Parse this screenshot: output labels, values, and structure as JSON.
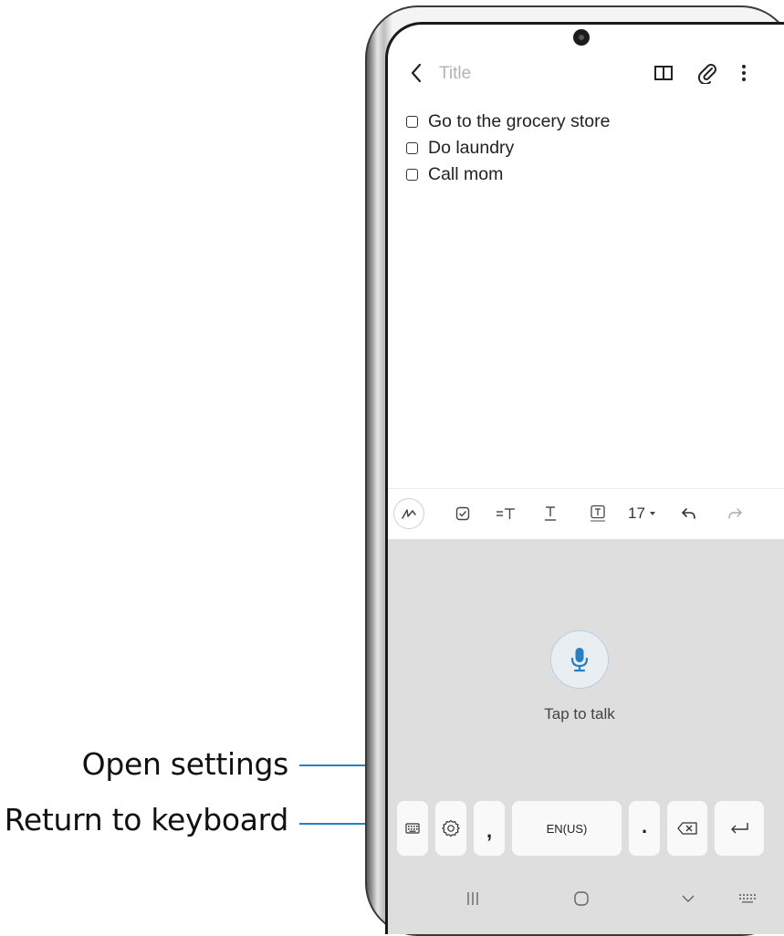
{
  "callouts": {
    "settings": "Open settings",
    "keyboard": "Return to keyboard"
  },
  "note": {
    "title_placeholder": "Title",
    "items": [
      {
        "text": "Go to the grocery store",
        "checked": false
      },
      {
        "text": "Do laundry",
        "checked": false
      },
      {
        "text": "Call mom",
        "checked": false
      }
    ]
  },
  "app_bar": {
    "icons": [
      "back-icon",
      "book-icon",
      "attach-icon",
      "more-options-icon"
    ]
  },
  "toolbar": {
    "icons": [
      "handwriting-pen-icon",
      "checkbox-icon",
      "text-style-icon",
      "underline-text-icon",
      "text-background-icon",
      "font-size-dropdown",
      "undo-icon",
      "redo-icon"
    ],
    "font_size": "17"
  },
  "voice": {
    "tap_label": "Tap to talk",
    "accent": "#2a7fc0"
  },
  "keyboard_row": {
    "comma": ",",
    "language": "EN(US)",
    "period": "."
  },
  "nav_bar": {
    "icons": [
      "recent-apps-icon",
      "home-icon",
      "back-nav-icon",
      "keyboard-switch-icon"
    ]
  }
}
